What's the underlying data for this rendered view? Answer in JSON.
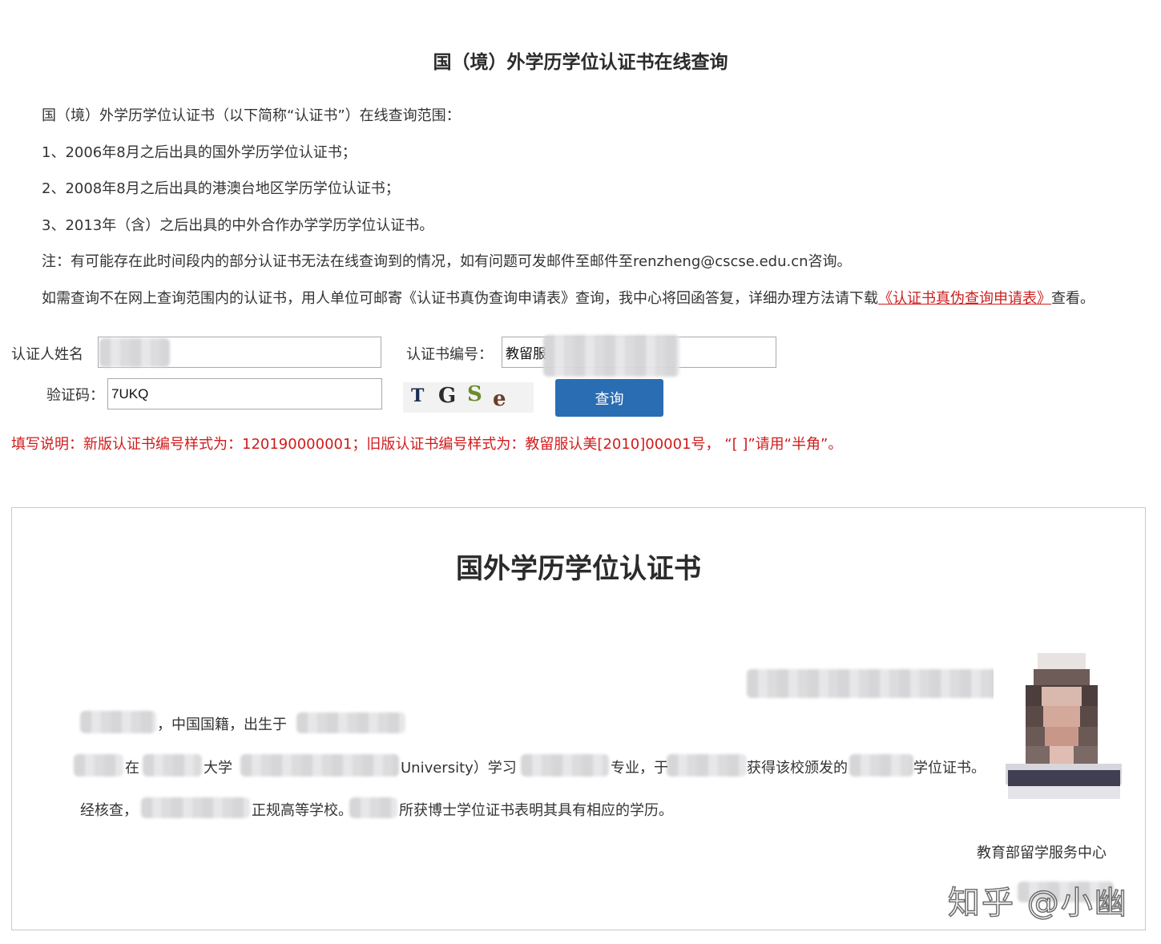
{
  "page": {
    "title": "国（境）外学历学位认证书在线查询"
  },
  "intro": {
    "scope_heading": "国（境）外学历学位认证书（以下简称“认证书”）在线查询范围：",
    "items": [
      "1、2006年8月之后出具的国外学历学位认证书；",
      "2、2008年8月之后出具的港澳台地区学历学位认证书；",
      "3、2013年（含）之后出具的中外合作办学学历学位认证书。"
    ],
    "note": "注：有可能存在此时间段内的部分认证书无法在线查询到的情况，如有问题可发邮件至邮件至renzheng@cscse.edu.cn咨询。",
    "mail_text_before": "如需查询不在网上查询范围内的认证书，用人单位可邮寄《认证书真伪查询申请表》查询，我中心将回函答复，详细办理方法请下载",
    "mail_link": "《认证书真伪查询申请表》",
    "mail_text_after": "查看。"
  },
  "form": {
    "name_label": "认证人姓名",
    "name_value": "",
    "cert_no_label": "认证书编号：",
    "cert_no_value": "教留服",
    "captcha_label": "验证码：",
    "captcha_value": "7UKQ",
    "captcha_image_text": [
      "T",
      "G",
      "S",
      "e"
    ],
    "search_button": "查询"
  },
  "instructions": "填写说明：新版认证书编号样式为：120190000001；旧版认证书编号样式为：教留服认美[2010]00001号， “[ ]”请用“半角”。",
  "certificate": {
    "title": "国外学历学位认证书",
    "line1_a": "，中国国籍，出生于",
    "line2_a": "在",
    "line2_b": "大学",
    "line2_c": "University）学习",
    "line2_d": "专业，于",
    "line2_e": "获得该校颁发的",
    "line2_f": "学位证书。",
    "line3_a": "经核查，",
    "line3_b": "正规高等学校。",
    "line3_c": "所获博士学位证书表明其具有相应的学历。",
    "issuer": "教育部留学服务中心"
  },
  "watermark": "知乎 @小幽",
  "colors": {
    "accent_button": "#2a6db3",
    "warning_text": "#d11b1b",
    "link": "#cc1f1f"
  }
}
